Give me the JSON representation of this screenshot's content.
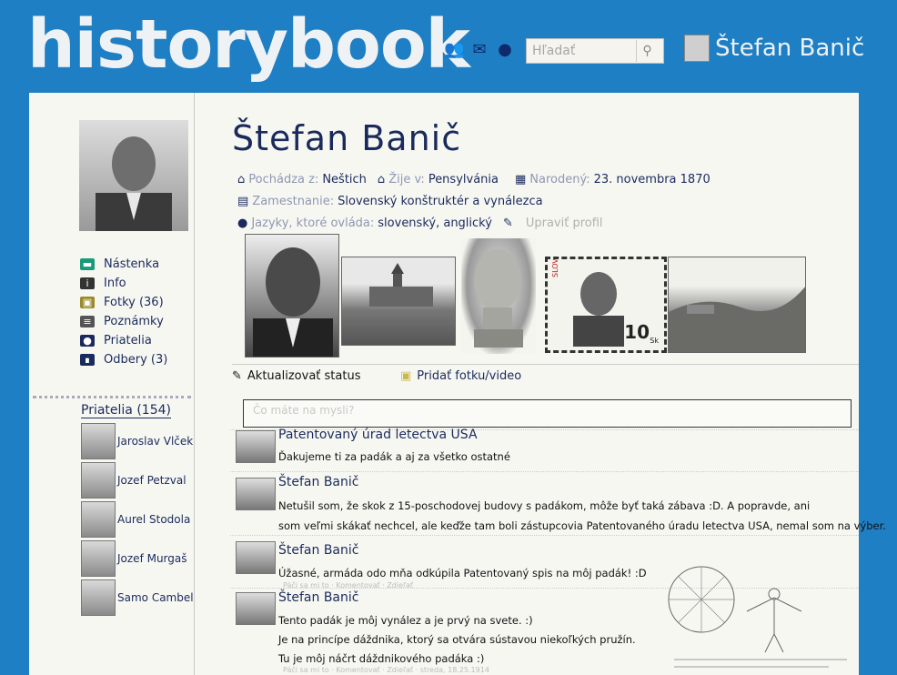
{
  "header": {
    "logo": "historybook",
    "icons": [
      "friends-icon",
      "messages-icon",
      "notifications-icon"
    ],
    "search": {
      "placeholder": "Hľadať"
    },
    "user_name": "Štefan Banič"
  },
  "sidebar": {
    "nav": [
      {
        "label": "Nástenka",
        "icon": "wall-icon",
        "color": "#1a9a7a"
      },
      {
        "label": "Info",
        "icon": "info-icon",
        "color": "#333333"
      },
      {
        "label": "Fotky (36)",
        "icon": "photos-icon",
        "color": "#9a8a2a"
      },
      {
        "label": "Poznámky",
        "icon": "notes-icon",
        "color": "#555555"
      },
      {
        "label": "Priatelia",
        "icon": "friends-icon",
        "color": "#1a2a5c"
      },
      {
        "label": "Odbery (3)",
        "icon": "subscriptions-icon",
        "color": "#1a2a5c"
      }
    ],
    "friends_title": "Priatelia (154)",
    "friends": [
      "Jaroslav Vlček",
      "Jozef Petzval",
      "Aurel Stodola",
      "Jozef Murgaš",
      "Samo Cambel"
    ]
  },
  "profile": {
    "name": "Štefan Banič",
    "from_label": "Pochádza z:",
    "from_value": "Neštich",
    "lives_label": "Žije v:",
    "lives_value": "Pensylvánia",
    "born_label": "Narodený:",
    "born_value": "23. novembra 1870",
    "job_label": "Zamestnanie:",
    "job_value": "Slovenský konštruktér a vynálezca",
    "lang_label": "Jazyky, ktoré ovláda:",
    "lang_value": "slovenský, anglický",
    "edit_label": "Upraviť profil"
  },
  "photos": {
    "stamp_country": "SLOVENSKO",
    "stamp_value": "10",
    "stamp_unit": "Sk"
  },
  "actions": {
    "status": "Aktualizovať status",
    "add_photo": "Pridať fotku/video"
  },
  "status_box": {
    "placeholder": "Čo máte na mysli?"
  },
  "posts": [
    {
      "name": "Patentovaný úrad letectva USA",
      "lines": [
        "Ďakujeme ti za padák a aj za všetko ostatné"
      ]
    },
    {
      "name": "Štefan Banič",
      "lines": [
        "Netušil som, že skok z 15-poschodovej budovy s padákom, môže byť taká zábava :D. A popravde, ani",
        "som veľmi skákať nechcel, ale keďže tam boli zástupcovia Patentovaného úradu letectva USA, nemal som na výber."
      ]
    },
    {
      "name": "Štefan Banič",
      "lines": [
        "Úžasné, armáda odo mňa odkúpila Patentovaný spis na môj padák! :D"
      ],
      "meta": "Páči sa mi to · Komentovať · Zdieľať"
    },
    {
      "name": "Štefan Banič",
      "lines": [
        "Tento padák je môj vynález a je prvý na svete. :)",
        "Je na princípe dáždnika, ktorý sa otvára sústavou niekoľkých pružín.",
        "Tu je môj náčrt dáždnikového padáka :)"
      ],
      "meta": "Páči sa mi to · Komentovať · Zdieľať · streda, 18.25.1914"
    }
  ]
}
